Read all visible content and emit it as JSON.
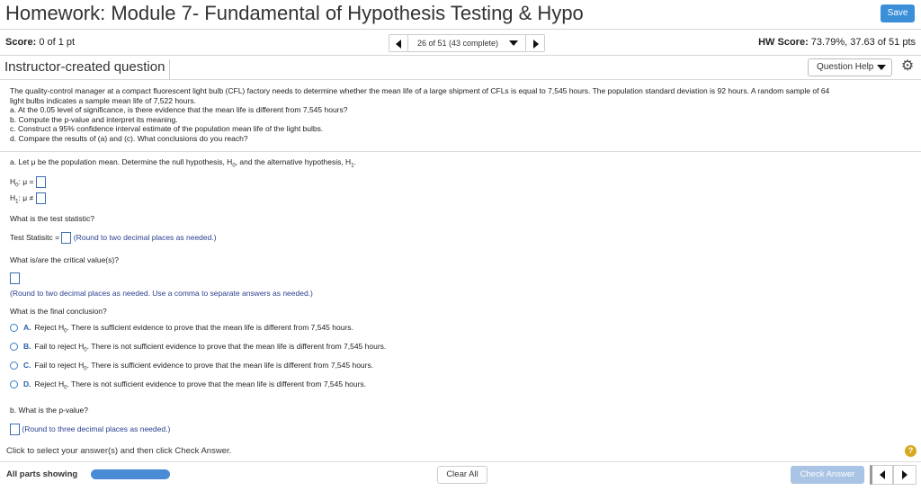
{
  "header": {
    "title": "Homework: Module 7- Fundamental of Hypothesis Testing & Hypo",
    "save_label": "Save"
  },
  "score_bar": {
    "score_label": "Score:",
    "score_value": "0 of 1 pt",
    "question_nav": "26 of 51 (43 complete)",
    "hw_score_label": "HW Score:",
    "hw_score_value": "73.79%, 37.63 of 51 pts"
  },
  "question_header": {
    "instructor_label": "Instructor-created question",
    "question_help_label": "Question Help"
  },
  "problem": {
    "line1": "The quality-control manager at a compact fluorescent light bulb (CFL) factory needs to determine whether the mean life of a large shipment of CFLs is equal to 7,545 hours. The population standard deviation is 92 hours. A random sample of 64",
    "line2": "light bulbs indicates a sample mean life of 7,522 hours.",
    "line_a": "a. At the 0.05 level of significance, is there evidence that the mean life is different from 7,545 hours?",
    "line_b": "b. Compute the p-value and interpret its meaning.",
    "line_c": "c. Construct a 95% confidence interval estimate of the population mean life of the light bulbs.",
    "line_d": "d. Compare the results of (a) and (c). What conclusions do you reach?"
  },
  "part_a": {
    "intro_prefix": "a. Let ",
    "mu": "μ",
    "intro_mid1": " be the population mean. Determine the null hypothesis, H",
    "sub0": "0",
    "intro_mid2": ", and the alternative hypothesis, H",
    "sub1": "1",
    "intro_end": ".",
    "h0_prefix": "H",
    "h0_sub": "0",
    "h0_rel": ": μ =",
    "h1_prefix": "H",
    "h1_sub": "1",
    "h1_rel": ": μ ≠",
    "test_stat_question": "What is the test statistic?",
    "test_stat_label": "Test Statisitc =",
    "test_stat_hint": "(Round to two decimal places as needed.)",
    "critical_question": "What is/are the critical value(s)?",
    "critical_hint": "(Round to two decimal places as needed. Use a comma to separate answers as needed.)",
    "conclusion_question": "What is the final conclusion?",
    "options": [
      {
        "letter": "A.",
        "pre": "Reject H",
        "sub": "0",
        "post": ". There is sufficient evidence to prove that the mean life is different from 7,545 hours."
      },
      {
        "letter": "B.",
        "pre": "Fail to reject H",
        "sub": "0",
        "post": ". There is not sufficient evidence to prove that the mean life is different from 7,545 hours."
      },
      {
        "letter": "C.",
        "pre": "Fail to reject H",
        "sub": "0",
        "post": ". There is sufficient evidence to prove that the mean life is different from 7,545 hours."
      },
      {
        "letter": "D.",
        "pre": "Reject H",
        "sub": "0",
        "post": ". There is not sufficient evidence to prove that the mean life is different from 7,545 hours."
      }
    ]
  },
  "part_b": {
    "question": "b. What is the p-value?",
    "hint": "(Round to three decimal places as needed.)"
  },
  "footer": {
    "instruction": "Click to select your answer(s) and then click Check Answer.",
    "help_glyph": "?",
    "parts_label": "All parts showing",
    "clear_label": "Clear All",
    "check_label": "Check Answer"
  },
  "colors": {
    "accent": "#3a8fd8",
    "hint": "#2a3f8f",
    "progress": "#4a8bd6",
    "check_disabled": "#a9c4e4",
    "help": "#d6a91e"
  }
}
